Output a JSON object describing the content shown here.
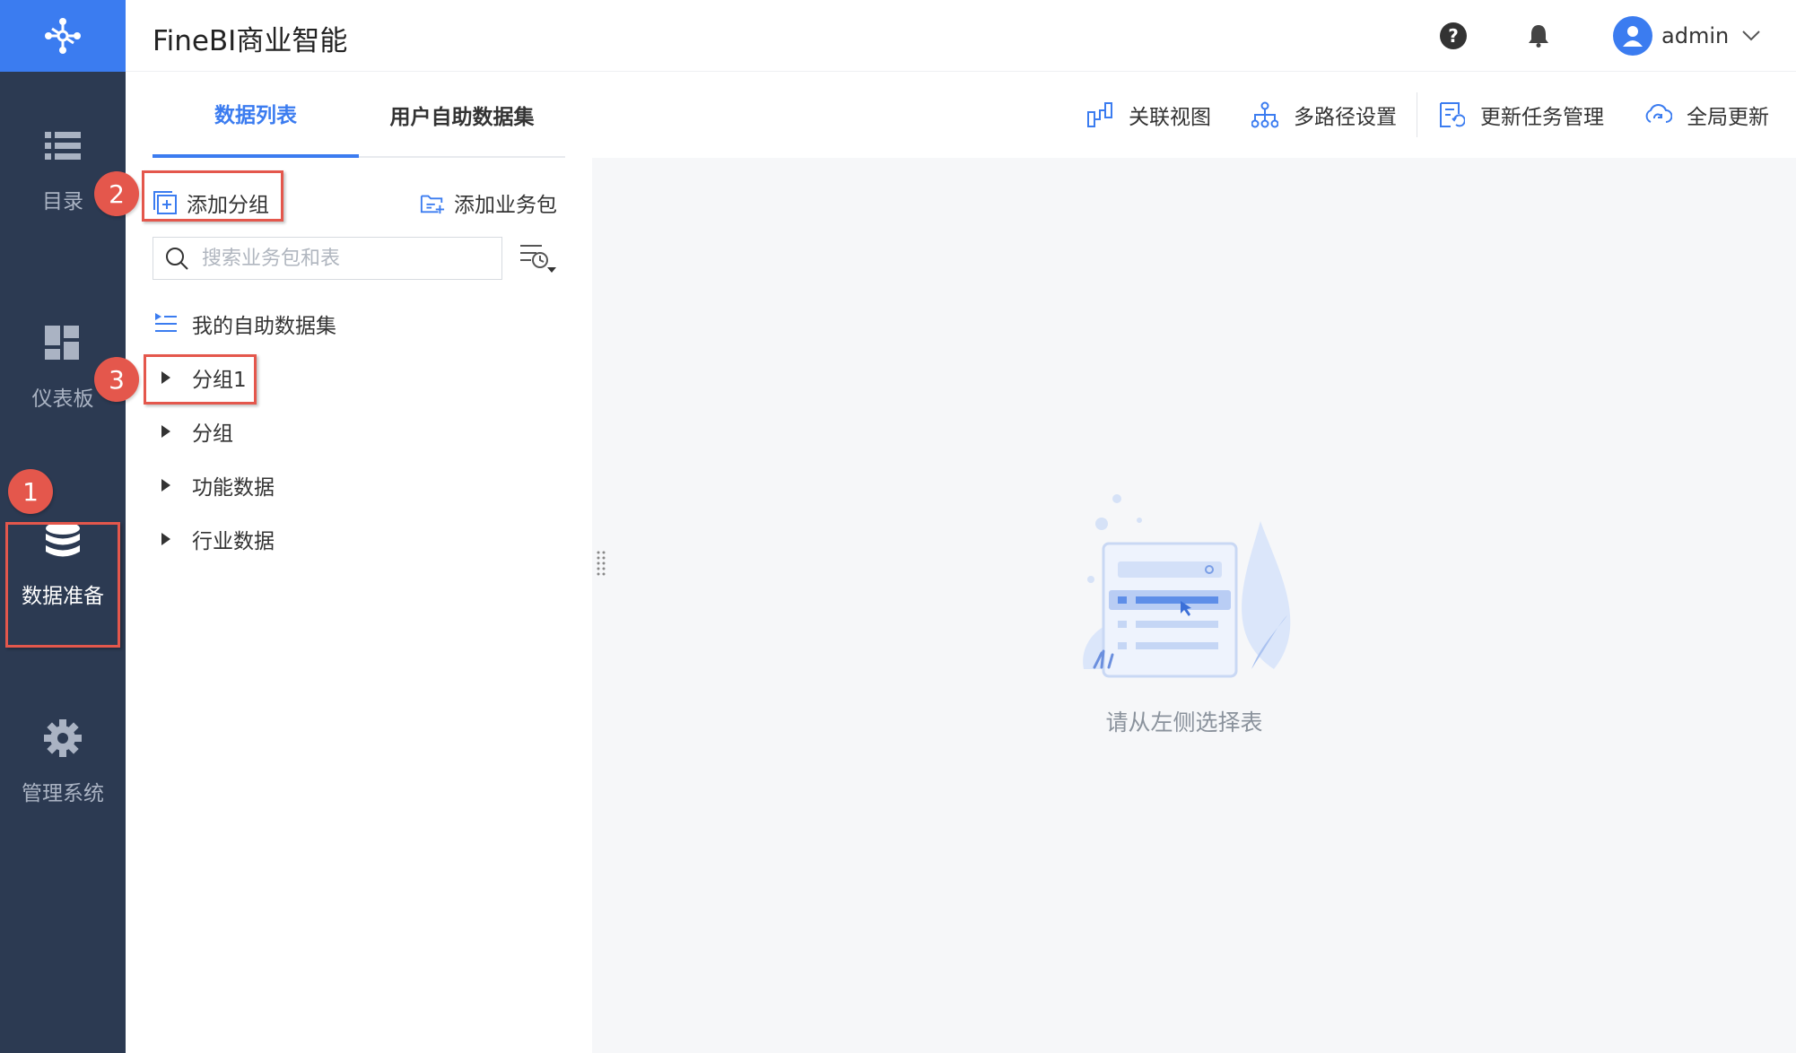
{
  "app": {
    "title": "FineBI商业智能"
  },
  "rail": {
    "items": [
      {
        "label": "目录",
        "icon": "list-icon"
      },
      {
        "label": "仪表板",
        "icon": "dashboard-icon"
      },
      {
        "label": "数据准备",
        "icon": "database-icon",
        "active": true
      },
      {
        "label": "管理系统",
        "icon": "gear-icon"
      }
    ]
  },
  "header": {
    "user": "admin"
  },
  "tabs": [
    {
      "label": "数据列表",
      "active": true
    },
    {
      "label": "用户自助数据集"
    }
  ],
  "toolbar": [
    {
      "label": "关联视图",
      "icon": "relation-view-icon"
    },
    {
      "label": "多路径设置",
      "icon": "multipath-icon"
    },
    {
      "label": "更新任务管理",
      "icon": "update-task-icon"
    },
    {
      "label": "全局更新",
      "icon": "cloud-refresh-icon"
    }
  ],
  "panel": {
    "add_group": "添加分组",
    "add_package": "添加业务包",
    "search_placeholder": "搜索业务包和表",
    "my_dataset": "我的自助数据集",
    "groups": [
      "分组1",
      "分组",
      "功能数据",
      "行业数据"
    ]
  },
  "main": {
    "empty_text": "请从左侧选择表"
  },
  "annotations": [
    "1",
    "2",
    "3"
  ],
  "colors": {
    "accent": "#3b7cf0",
    "rail": "#2c3a52",
    "annotation": "#e4574c"
  }
}
